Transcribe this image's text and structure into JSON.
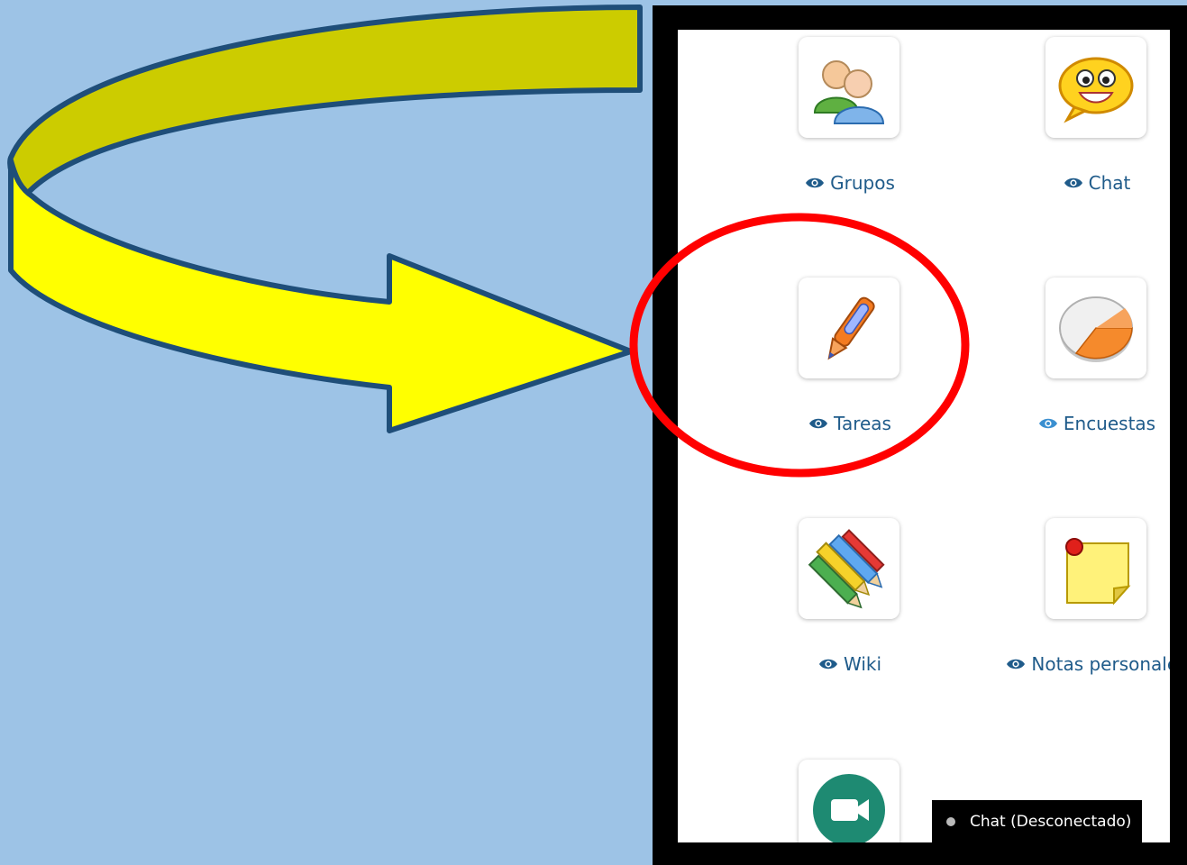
{
  "tools": [
    {
      "id": "grupos",
      "label": "Grupos",
      "icon": "groups-icon"
    },
    {
      "id": "chat",
      "label": "Chat",
      "icon": "chat-smiley-icon"
    },
    {
      "id": "tareas",
      "label": "Tareas",
      "icon": "pen-icon"
    },
    {
      "id": "encuestas",
      "label": "Encuestas",
      "icon": "pie-chart-icon"
    },
    {
      "id": "wiki",
      "label": "Wiki",
      "icon": "colored-pencils-icon"
    },
    {
      "id": "notas",
      "label": "Notas personales",
      "icon": "sticky-note-icon"
    },
    {
      "id": "meet",
      "label": "",
      "icon": "video-camera-icon"
    }
  ],
  "chat_status": {
    "label": "Chat (Desconectado)",
    "status_color": "#b9b9b9"
  },
  "colors": {
    "background": "#9dc3e6",
    "link": "#1f5b8a",
    "arrow_fill": "#ffff00",
    "arrow_outline": "#1f4e79",
    "highlight": "#ff0000"
  }
}
